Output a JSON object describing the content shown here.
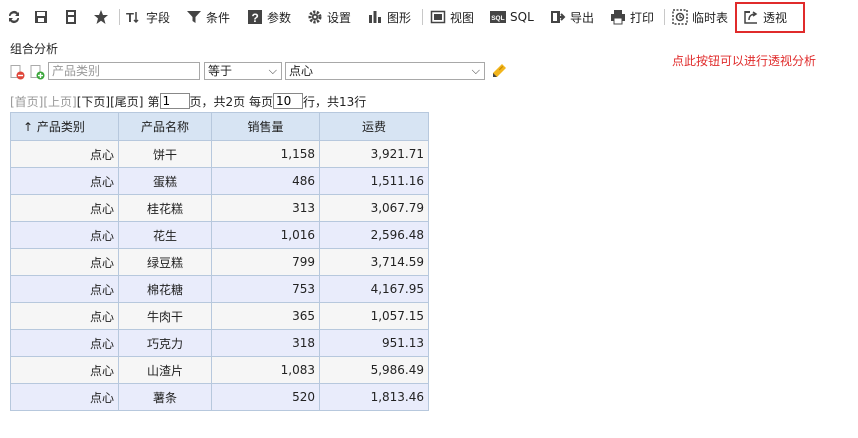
{
  "toolbar": {
    "field": "字段",
    "condition": "条件",
    "params": "参数",
    "settings": "设置",
    "chart": "图形",
    "view": "视图",
    "sql": "SQL",
    "export": "导出",
    "print": "打印",
    "temp_table": "临时表",
    "pivot": "透视"
  },
  "hint_text": "点此按钮可以进行透视分析",
  "section_title": "组合分析",
  "filter": {
    "field_placeholder": "产品类别",
    "operator": "等于",
    "value": "点心"
  },
  "pager": {
    "first": "[首页]",
    "prev": "[上页]",
    "next": "[下页]",
    "last": "[尾页]",
    "page_prefix": "第",
    "current_page": "1",
    "page_suffix": "页，共2页 每页",
    "page_size": "10",
    "rows_suffix": "行，共13行"
  },
  "table": {
    "headers": [
      "↑ 产品类别",
      "产品名称",
      "销售量",
      "运费"
    ],
    "rows": [
      [
        "点心",
        "饼干",
        "1,158",
        "3,921.71"
      ],
      [
        "点心",
        "蛋糕",
        "486",
        "1,511.16"
      ],
      [
        "点心",
        "桂花糕",
        "313",
        "3,067.79"
      ],
      [
        "点心",
        "花生",
        "1,016",
        "2,596.48"
      ],
      [
        "点心",
        "绿豆糕",
        "799",
        "3,714.59"
      ],
      [
        "点心",
        "棉花糖",
        "753",
        "4,167.95"
      ],
      [
        "点心",
        "牛肉干",
        "365",
        "1,057.15"
      ],
      [
        "点心",
        "巧克力",
        "318",
        "951.13"
      ],
      [
        "点心",
        "山渣片",
        "1,083",
        "5,986.49"
      ],
      [
        "点心",
        "薯条",
        "520",
        "1,813.46"
      ]
    ]
  },
  "colors": {
    "highlight": "#e02b2b",
    "header_bg": "#d7e4f3",
    "row_alt": "#e9ecfb"
  }
}
